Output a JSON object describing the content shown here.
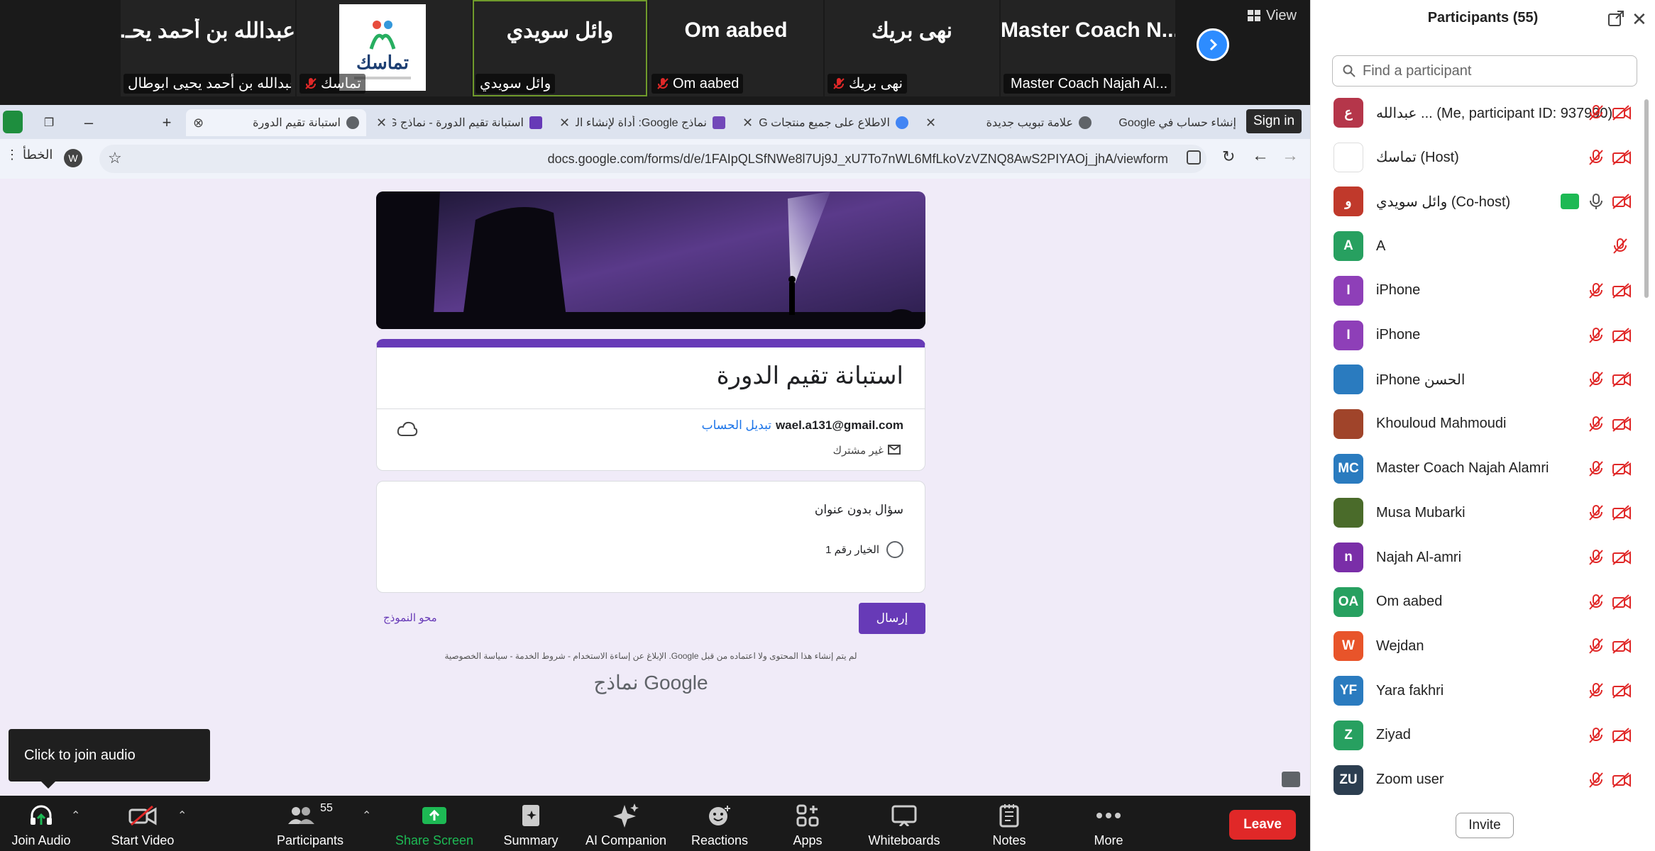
{
  "gallery": {
    "tiles": [
      {
        "big": "عبدالله بن أحمد يحـ...",
        "foot": "عبدالله بن أحمد يحيى ابوطال..."
      },
      {
        "big": "",
        "foot": "تماسك",
        "logo_text": "تماسك"
      },
      {
        "big": "وائل سويدي",
        "foot": "وائل سويدي"
      },
      {
        "big": "Om aabed",
        "foot": "Om aabed"
      },
      {
        "big": "نهى بريك",
        "foot": "نهى بريك"
      },
      {
        "big": "Master  Coach  N...",
        "foot": "Master Coach Najah Al..."
      }
    ],
    "view_label": "View"
  },
  "browser": {
    "profile_label": "الخطأ",
    "profile_initial": "W",
    "signin_label": "Sign in",
    "url": "docs.google.com/forms/d/e/1FAIpQLSfNWe8l7Uj9J_xU7To7nWL6MfLkoVzVZNQ8AwS2PIYAOj_jhA/viewform",
    "tabs": [
      {
        "title": "استبانة تقيم الدورة",
        "color": "#5f6368"
      },
      {
        "title": "استبانة تقيم الدورة - نماذج G",
        "color": "#673ab7"
      },
      {
        "title": "نماذج Google: أداة لإنشاء الن",
        "color": "#7248b9"
      },
      {
        "title": "الاطلاع على جميع منتجات G",
        "color": "#4285f4"
      },
      {
        "title": "علامة تبويب جديدة",
        "color": "#5f6368"
      },
      {
        "title": "إنشاء حساب في Google",
        "color": "#5f6368"
      }
    ]
  },
  "form": {
    "title": "استبانة تقيم الدورة",
    "email": "wael.a131@gmail.com",
    "switch_account": "تبديل الحساب",
    "not_shared": "غير مشترك",
    "question": "سؤال بدون عنوان",
    "option": "الخيار رقم 1",
    "submit": "إرسال",
    "clear": "محو النموذج",
    "disclaimer": "لم يتم إنشاء هذا المحتوى ولا اعتماده من قبل Google. الإبلاغ عن إساءة الاستخدام - شروط الخدمة - سياسة الخصوصية",
    "brand": "Google نماذج"
  },
  "tooltip": "Click to join audio",
  "toolbar": {
    "join_audio": "Join Audio",
    "start_video": "Start Video",
    "participants": "Participants",
    "participants_count": "55",
    "share_screen": "Share Screen",
    "summary": "Summary",
    "ai_companion": "AI Companion",
    "reactions": "Reactions",
    "apps": "Apps",
    "whiteboards": "Whiteboards",
    "notes": "Notes",
    "more": "More",
    "leave": "Leave"
  },
  "panel": {
    "title": "Participants (55)",
    "search_placeholder": "Find a participant",
    "invite": "Invite",
    "participants": [
      {
        "name": "عبدالله ...  (Me, participant ID: 937990)",
        "initial": "ع",
        "color": "#b5364a",
        "mic_muted": true,
        "cam_off": true
      },
      {
        "name": "تماسك (Host)",
        "initial": "",
        "color": "#ffffff",
        "mic_muted": true,
        "cam_off": true
      },
      {
        "name": "وائل سويدي (Co-host)",
        "initial": "و",
        "color": "#c0392b",
        "mic_muted": false,
        "cam_off": true
      },
      {
        "name": "A",
        "initial": "A",
        "color": "#27a060",
        "mic_muted": true,
        "cam_off": false
      },
      {
        "name": "iPhone",
        "initial": "I",
        "color": "#8e3fb8",
        "mic_muted": true,
        "cam_off": true
      },
      {
        "name": "iPhone",
        "initial": "I",
        "color": "#8e3fb8",
        "mic_muted": true,
        "cam_off": true
      },
      {
        "name": "iPhone الحسن",
        "initial": "",
        "color": "#2a7bbf",
        "mic_muted": true,
        "cam_off": true
      },
      {
        "name": "Khouloud Mahmoudi",
        "initial": "",
        "color": "#a0442a",
        "mic_muted": true,
        "cam_off": true
      },
      {
        "name": "Master Coach Najah Alamri",
        "initial": "MC",
        "color": "#2a7bbf",
        "mic_muted": true,
        "cam_off": true
      },
      {
        "name": "Musa Mubarki",
        "initial": "",
        "color": "#4a6b2a",
        "mic_muted": true,
        "cam_off": true
      },
      {
        "name": "Najah Al-amri",
        "initial": "n",
        "color": "#7a2ea8",
        "mic_muted": true,
        "cam_off": true
      },
      {
        "name": "Om aabed",
        "initial": "OA",
        "color": "#27a060",
        "mic_muted": true,
        "cam_off": true
      },
      {
        "name": "Wejdan",
        "initial": "W",
        "color": "#e8542a",
        "mic_muted": true,
        "cam_off": true
      },
      {
        "name": "Yara fakhri",
        "initial": "YF",
        "color": "#2a7bbf",
        "mic_muted": true,
        "cam_off": true
      },
      {
        "name": "Ziyad",
        "initial": "Z",
        "color": "#27a060",
        "mic_muted": true,
        "cam_off": true
      },
      {
        "name": "Zoom user",
        "initial": "ZU",
        "color": "#2c3e50",
        "mic_muted": true,
        "cam_off": true
      }
    ]
  }
}
